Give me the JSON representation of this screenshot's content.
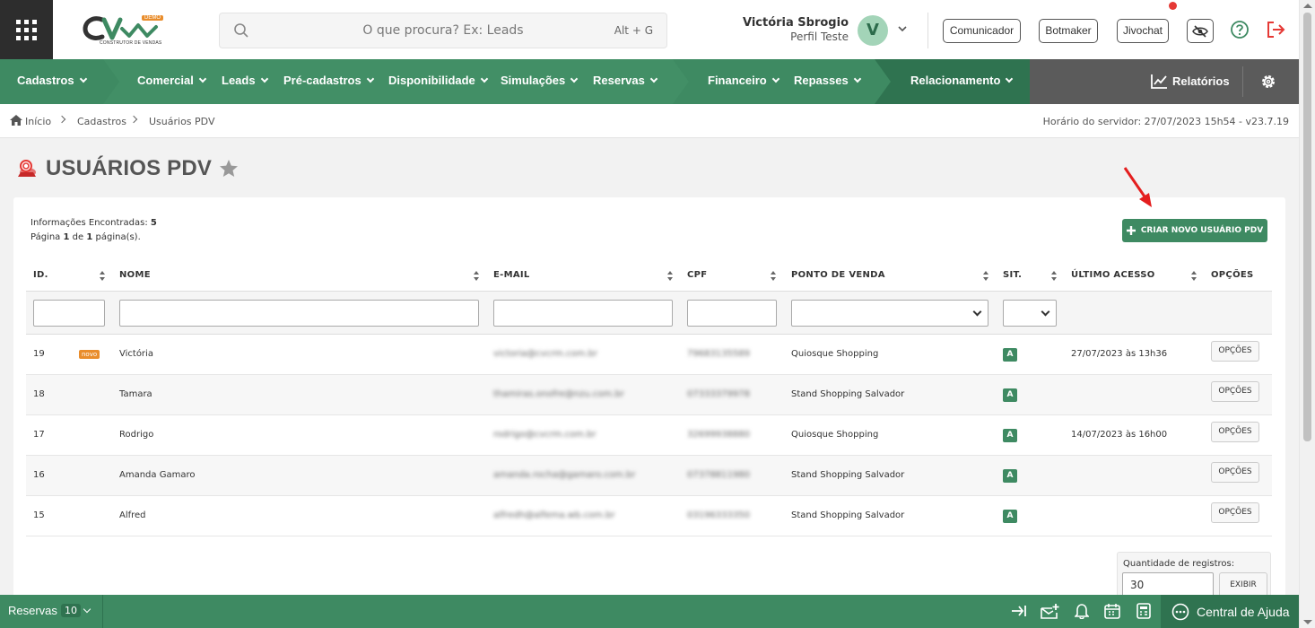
{
  "header": {
    "logo_text": "CV",
    "logo_badge": "DEMO",
    "logo_subtitle": "CONSTRUTOR DE VENDAS",
    "search_placeholder": "O que procura? Ex: Leads",
    "search_shortcut": "Alt + G",
    "user_name": "Victória Sbrogio",
    "user_profile": "Perfil Teste",
    "avatar_initial": "V",
    "buttons": [
      "Comunicador",
      "Botmaker",
      "Jivochat"
    ]
  },
  "nav": {
    "items": [
      "Cadastros",
      "Comercial",
      "Leads",
      "Pré-cadastros",
      "Disponibilidade",
      "Simulações",
      "Reservas",
      "Financeiro",
      "Repasses",
      "Relacionamento"
    ],
    "reports": "Relatórios"
  },
  "breadcrumb": {
    "items": [
      "Início",
      "Cadastros",
      "Usuários PDV"
    ],
    "server_time": "Horário do servidor: 27/07/2023 15h54 - v23.7.19"
  },
  "page": {
    "title": "USUÁRIOS PDV",
    "found_label": "Informações Encontradas:",
    "found_count": "5",
    "page_prefix": "Página",
    "page_current": "1",
    "page_of": "de",
    "page_total": "1",
    "page_suffix": "página(s).",
    "create_button": "CRIAR NOVO USUÁRIO PDV"
  },
  "table": {
    "columns": [
      "ID.",
      "NOME",
      "E-MAIL",
      "CPF",
      "PONTO DE VENDA",
      "SIT.",
      "ÚLTIMO ACESSO",
      "OPÇÕES"
    ],
    "rows": [
      {
        "id": "19",
        "badge": "novo",
        "name": "Victória",
        "email": "victoria@cvcrm.com.br",
        "cpf": "79683135589",
        "pdv": "Quiosque Shopping",
        "sit": "A",
        "last": "27/07/2023 às 13h36",
        "opt": "OPÇÕES"
      },
      {
        "id": "18",
        "badge": "",
        "name": "Tamara",
        "email": "thamiras.onofre@nzu.com.br",
        "cpf": "07333379978",
        "pdv": "Stand Shopping Salvador",
        "sit": "A",
        "last": "",
        "opt": "OPÇÕES"
      },
      {
        "id": "17",
        "badge": "",
        "name": "Rodrigo",
        "email": "rodrigo@cvcrm.com.br",
        "cpf": "32699938880",
        "pdv": "Quiosque Shopping",
        "sit": "A",
        "last": "14/07/2023 às 16h00",
        "opt": "OPÇÕES"
      },
      {
        "id": "16",
        "badge": "",
        "name": "Amanda Gamaro",
        "email": "amanda.rocha@gamaro.com.br",
        "cpf": "07378811980",
        "pdv": "Stand Shopping Salvador",
        "sit": "A",
        "last": "",
        "opt": "OPÇÕES"
      },
      {
        "id": "15",
        "badge": "",
        "name": "Alfred",
        "email": "alfredh@alfema.wb.com.br",
        "cpf": "03196333350",
        "pdv": "Stand Shopping Salvador",
        "sit": "A",
        "last": "",
        "opt": "OPÇÕES"
      }
    ]
  },
  "pagination": {
    "qty_label": "Quantidade de registros:",
    "qty_value": "30",
    "show_button": "EXIBIR"
  },
  "bottom": {
    "reservas_label": "Reservas",
    "reservas_count": "10",
    "help_center": "Central de Ajuda"
  }
}
